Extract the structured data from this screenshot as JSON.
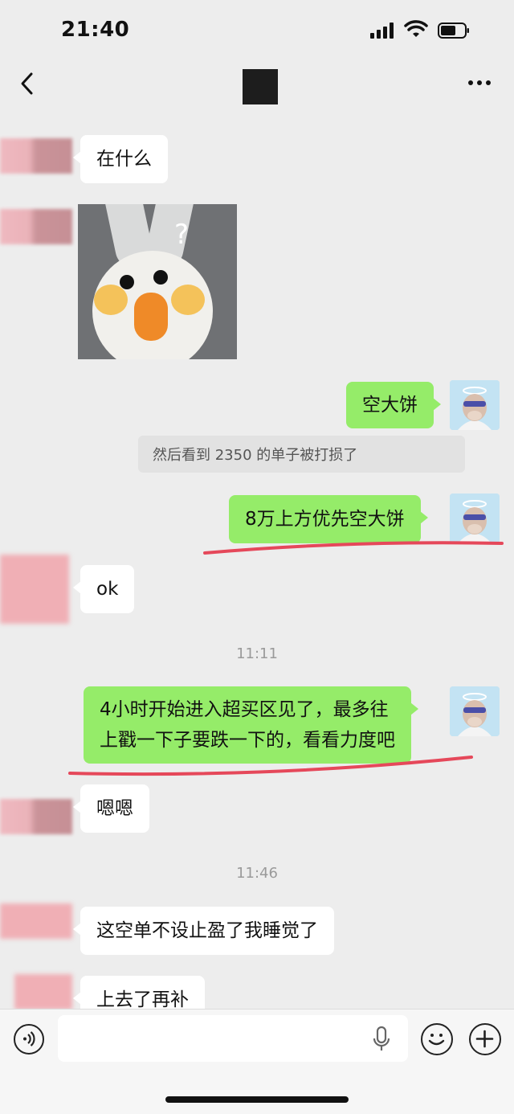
{
  "status_bar": {
    "time": "21:40"
  },
  "header": {
    "more_icon": "more-icon",
    "back_icon": "back-icon"
  },
  "messages": [
    {
      "side": "left",
      "text": "在什么"
    },
    {
      "side": "left",
      "type": "sticker",
      "sticker_text": "?"
    },
    {
      "side": "right",
      "text": "空大饼"
    },
    {
      "side": "right",
      "type": "quote",
      "text": "然后看到 2350 的单子被打损了"
    },
    {
      "side": "right",
      "text": "8万上方优先空大饼"
    },
    {
      "side": "left",
      "text": "ok"
    },
    {
      "type": "time",
      "text": "11:11"
    },
    {
      "side": "right",
      "lines": [
        "4小时开始进入超买区见了，最多往",
        "上戳一下子要跌一下的，看看力度吧"
      ]
    },
    {
      "side": "left",
      "text": "嗯嗯"
    },
    {
      "type": "time",
      "text": "11:46"
    },
    {
      "side": "left",
      "text": "这空单不设止盈了我睡觉了"
    },
    {
      "side": "left",
      "text": "上去了再补"
    }
  ],
  "input_bar": {
    "placeholder": ""
  },
  "colors": {
    "green_bubble": "#95ec69",
    "background": "#ededed",
    "underline": "#e5485a"
  }
}
